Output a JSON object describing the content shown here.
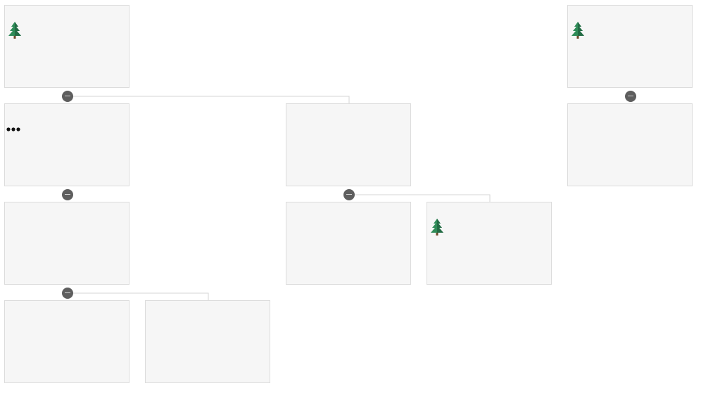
{
  "colors": {
    "card_background": "#f6f6f6",
    "card_border": "#dcdcdc",
    "connector": "#d6d6d6",
    "collapse_button": "#5e5e5e",
    "tree_icon": "#2e8b57"
  },
  "icons": {
    "tree": "evergreen-tree-icon",
    "more": "ellipsis-icon",
    "collapse": "minus-icon"
  }
}
